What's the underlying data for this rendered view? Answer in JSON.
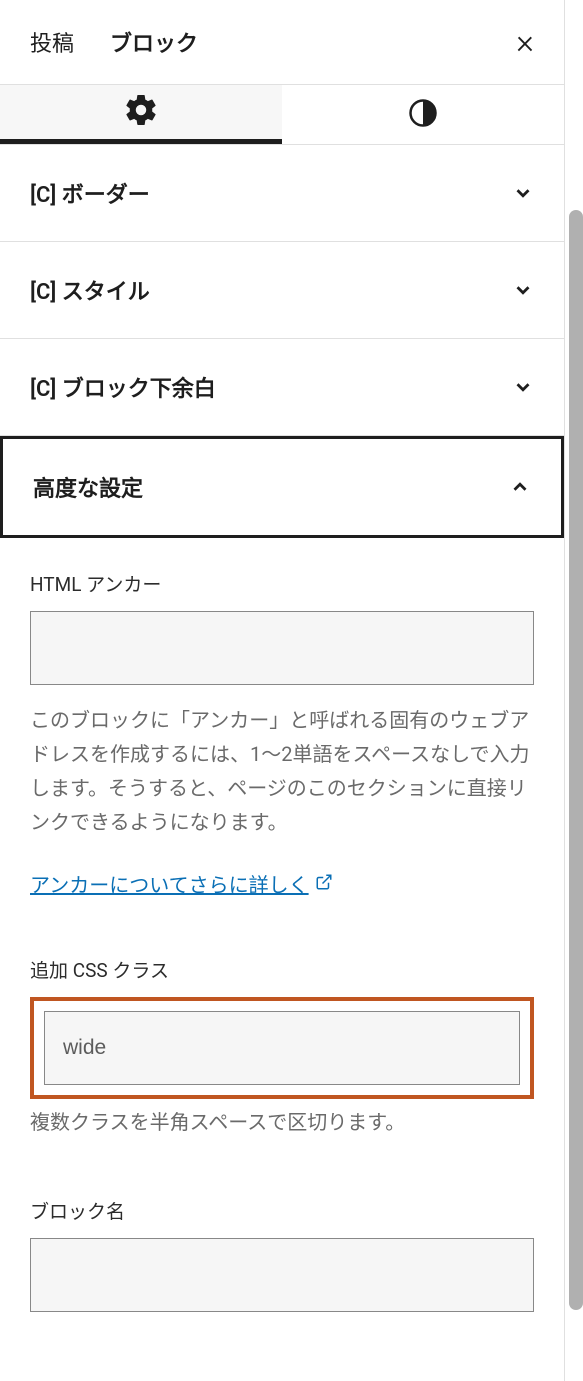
{
  "tabs": {
    "post": "投稿",
    "block": "ブロック"
  },
  "panels": {
    "border": "[C] ボーダー",
    "style": "[C] スタイル",
    "margin_bottom": "[C] ブロック下余白",
    "advanced": "高度な設定"
  },
  "advanced": {
    "anchor_label": "HTML アンカー",
    "anchor_value": "",
    "anchor_help": "このブロックに「アンカー」と呼ばれる固有のウェブアドレスを作成するには、1〜2単語をスペースなしで入力します。そうすると、ページのこのセクションに直接リンクできるようになります。",
    "anchor_learn_more": "アンカーについてさらに詳しく",
    "css_label": "追加 CSS クラス",
    "css_value": "wide",
    "css_help": "複数クラスを半角スペースで区切ります。",
    "block_name_label": "ブロック名",
    "block_name_value": ""
  }
}
